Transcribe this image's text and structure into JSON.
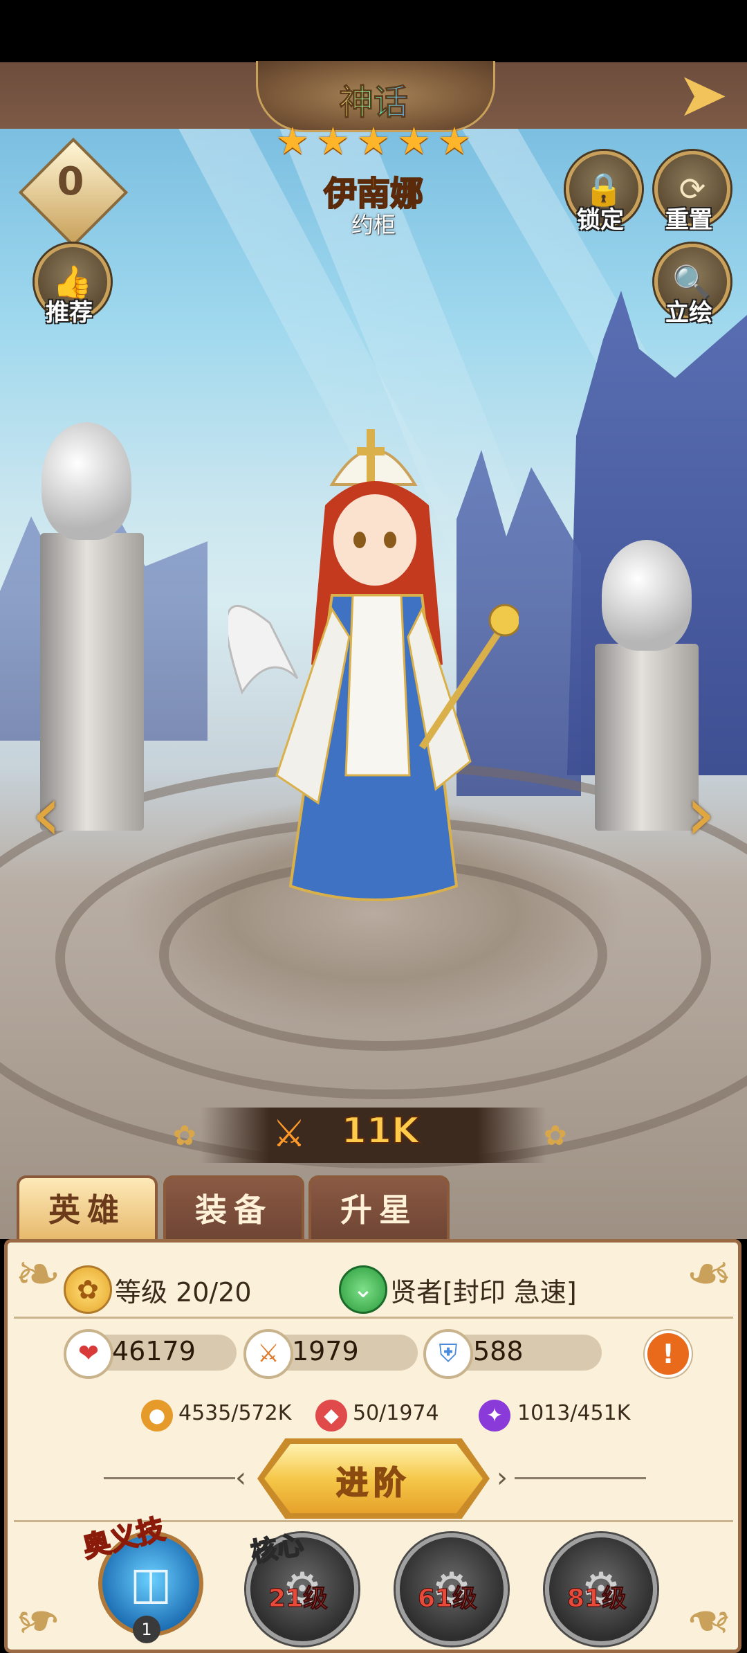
{
  "header": {
    "rarity": "神话",
    "stars": 5,
    "hero_name": "伊南娜",
    "faction": "约柜",
    "hero_level_badge": "0"
  },
  "buttons": {
    "lock": "锁定",
    "reset": "重置",
    "recommend": "推荐",
    "portrait": "立绘"
  },
  "power": {
    "value": "11K"
  },
  "tabs": [
    {
      "label": "英雄",
      "active": true
    },
    {
      "label": "装备",
      "active": false
    },
    {
      "label": "升星",
      "active": false
    }
  ],
  "panel": {
    "level": "等级 20/20",
    "class": "贤者[封印 急速]",
    "stats": {
      "hp": "46179",
      "attack": "1979",
      "defense": "588"
    },
    "resources": {
      "gold": "4535/572K",
      "gem": "50/1974",
      "essence": "1013/451K"
    },
    "advance_label": "进阶"
  },
  "skills": {
    "ult_label": "奥义技",
    "ult_count": "1",
    "core_label": "核心",
    "levels": [
      "21级",
      "61级",
      "81级"
    ]
  },
  "colors": {
    "accent": "#c9a15a",
    "panel_bg": "#fbf0da",
    "tab_active": "#e6b86a"
  }
}
